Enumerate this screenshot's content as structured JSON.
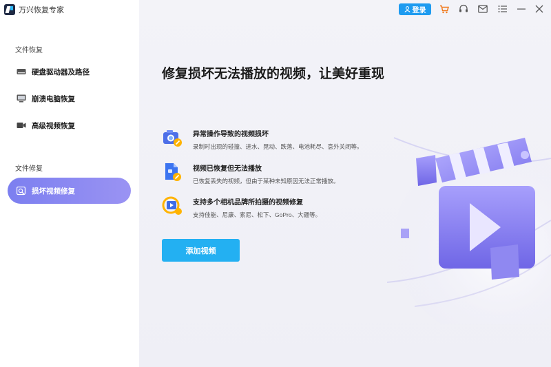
{
  "app": {
    "title": "万兴恢复专家"
  },
  "sidebar": {
    "section1": "文件恢复",
    "items": [
      {
        "label": "硬盘驱动器及路径",
        "icon": "hard-drive-icon"
      },
      {
        "label": "崩溃电脑恢复",
        "icon": "monitor-icon"
      },
      {
        "label": "高级视频恢复",
        "icon": "video-camera-icon"
      }
    ],
    "section2": "文件修复",
    "repair_items": [
      {
        "label": "损坏视频修复",
        "icon": "video-repair-icon",
        "active": true
      }
    ]
  },
  "topbar": {
    "login_label": "登录",
    "icons": [
      "user-icon",
      "cart-icon",
      "headset-icon",
      "mail-icon",
      "menu-icon",
      "minimize-icon",
      "close-icon"
    ]
  },
  "main": {
    "headline": "修复损坏无法播放的视频，让美好重现",
    "features": [
      {
        "title": "异常操作导致的视频损坏",
        "desc": "录制时出现的碰撞、进水、晃动、跌落、电池耗尽、意外关闭等。",
        "icon": "camera-repair-icon"
      },
      {
        "title": "视频已恢复但无法播放",
        "desc": "已恢复丢失的视频，但由于某种未知原因无法正常播放。",
        "icon": "file-repair-icon"
      },
      {
        "title": "支持多个相机品牌所拍摄的视频修复",
        "desc": "支持佳能、尼康、索尼、松下、GoPro、大疆等。",
        "icon": "camera-brands-icon"
      }
    ],
    "add_button": "添加视频"
  },
  "colors": {
    "accent": "#23b0f2",
    "active_nav": "#8a87f1",
    "login": "#1e9bf0"
  }
}
